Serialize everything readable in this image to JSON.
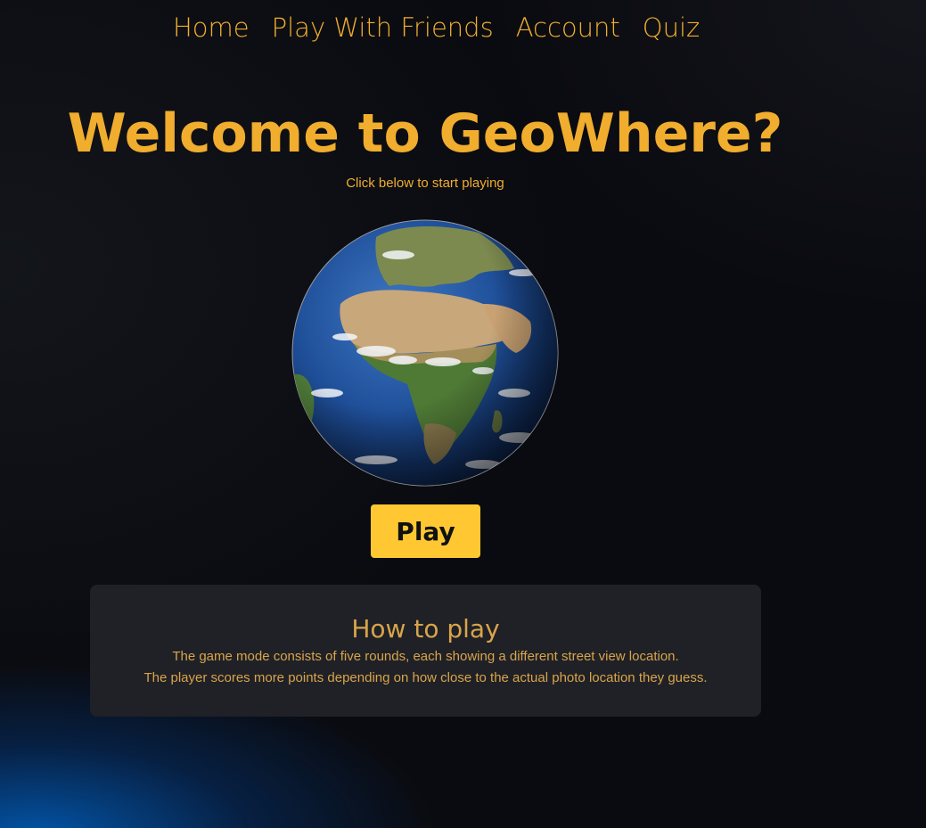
{
  "nav": {
    "items": [
      {
        "label": "Home"
      },
      {
        "label": "Play With Friends"
      },
      {
        "label": "Account"
      },
      {
        "label": "Quiz"
      }
    ]
  },
  "hero": {
    "title": "Welcome to GeoWhere?",
    "subtitle": "Click below to start playing",
    "globe_icon": "earth-globe-image"
  },
  "play_button": {
    "label": "Play"
  },
  "how_to_play": {
    "heading": "How to play",
    "lines": [
      "The game mode consists of five rounds, each showing a different street view location.",
      "The player scores more points depending on how close to the actual photo location they guess."
    ]
  },
  "colors": {
    "accent": "#f0ad2e",
    "button": "#ffc832",
    "panel": "#1f2127",
    "background": "#0a0b10"
  }
}
